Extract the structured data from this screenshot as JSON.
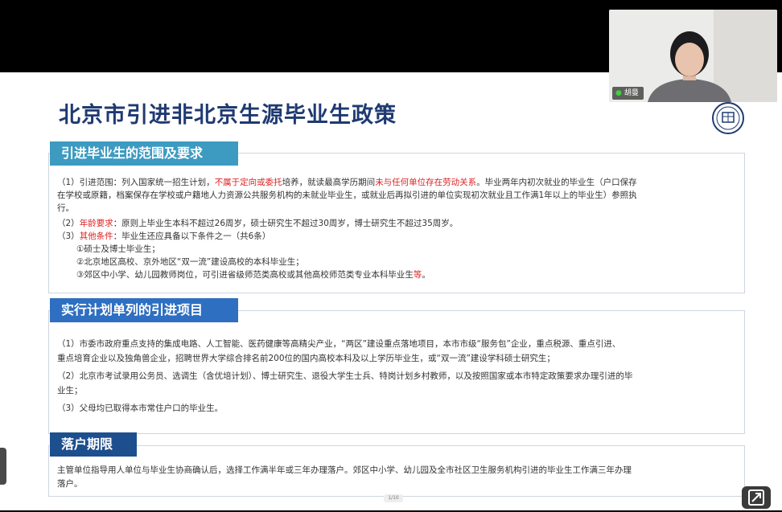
{
  "slide": {
    "title": "北京市引进非北京生源毕业生政策",
    "page_indicator": "1/10",
    "colors": {
      "title": "#1f3a72",
      "header_teal": "#3d9bc1",
      "header_blue": "#2e6fc1",
      "header_navy": "#1d4f8e",
      "highlight_red": "#dd2222"
    },
    "section1": {
      "header": "引进毕业生的范围及要求",
      "item1": {
        "p1": "（1）引进范围：列入国家统一招生计划，",
        "r1": "不属于定向或委托",
        "p2": "培养，就读最高学历期间",
        "r2": "未与任何单位存在劳动关系",
        "p3": "。毕业两年内初次就业的毕业生（户口保存",
        "l2": "在学校或原籍，档案保存在学校或户籍地人力资源公共服务机构的未就业毕业生，或就业后再拟引进的单位实现初次就业且工作满1年以上的毕业生）参照执",
        "l3": "行。"
      },
      "item2": {
        "p1": "（2）",
        "r1": "年龄要求",
        "p2": "：原则上毕业生本科不超过26周岁，硕士研究生不超过30周岁，博士研究生不超过35周岁。"
      },
      "item3": {
        "p1": "（3）",
        "r1": "其他条件",
        "p2": "：毕业生还应具备以下条件之一（共6条）"
      },
      "sub1": "①硕士及博士毕业生；",
      "sub2": "②北京地区高校、京外地区“双一流”建设高校的本科毕业生；",
      "sub3": {
        "p1": "③郊区中小学、幼儿园教师岗位，可引进省级师范类高校或其他高校师范类专业本科毕业生",
        "r1": "等",
        "p2": "。"
      }
    },
    "section2": {
      "header": "实行计划单列的引进项目",
      "item1_l1": "（1）市委市政府重点支持的集成电路、人工智能、医药健康等高精尖产业，“两区”建设重点落地项目，本市市级“服务包”企业，重点税源、重点引进、",
      "item1_l2": "重点培育企业以及独角兽企业，招聘世界大学综合排名前200位的国内高校本科及以上学历毕业生，或“双一流”建设学科硕士研究生；",
      "item2_l1": "（2）北京市考试录用公务员、选调生（含优培计划）、博士研究生、退役大学生士兵、特岗计划乡村教师，以及按照国家或本市特定政策要求办理引进的毕",
      "item2_l2": "业生；",
      "item3": "（3）父母均已取得本市常住户口的毕业生。"
    },
    "section3": {
      "header": "落户期限",
      "l1": "主管单位指导用人单位与毕业生协商确认后，选择工作满半年或三年办理落户。郊区中小学、幼儿园及全市社区卫生服务机构引进的毕业生工作满三年办理",
      "l2": "落户。"
    }
  },
  "webcam": {
    "name": "胡曼",
    "mic_icon": "microphone-icon"
  },
  "controls": {
    "expand_icon": "expand-arrow-icon"
  }
}
